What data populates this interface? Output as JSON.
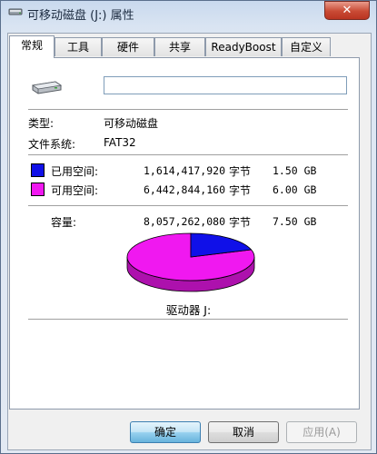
{
  "window": {
    "title": "可移动磁盘 (J:) 属性"
  },
  "tabs": [
    {
      "label": "常规",
      "active": true
    },
    {
      "label": "工具"
    },
    {
      "label": "硬件"
    },
    {
      "label": "共享"
    },
    {
      "label": "ReadyBoost"
    },
    {
      "label": "自定义"
    }
  ],
  "general": {
    "drive_name_value": "",
    "type_label": "类型:",
    "type_value": "可移动磁盘",
    "fs_label": "文件系统:",
    "fs_value": "FAT32",
    "used": {
      "label": "已用空间:",
      "bytes": "1,614,417,920",
      "unit": "字节",
      "size": "1.50 GB",
      "color": "#1010e8"
    },
    "free": {
      "label": "可用空间:",
      "bytes": "6,442,844,160",
      "unit": "字节",
      "size": "6.00 GB",
      "color": "#f018f0"
    },
    "capacity": {
      "label": "容量:",
      "bytes": "8,057,262,080",
      "unit": "字节",
      "size": "7.50 GB"
    },
    "pie_used_fraction": 0.2,
    "drive_label": "驱动器 J:"
  },
  "buttons": {
    "ok": "确定",
    "cancel": "取消",
    "apply": "应用(A)"
  },
  "icons": {
    "title": "drive-icon",
    "close": "close-icon",
    "drive": "usb-drive-icon"
  }
}
